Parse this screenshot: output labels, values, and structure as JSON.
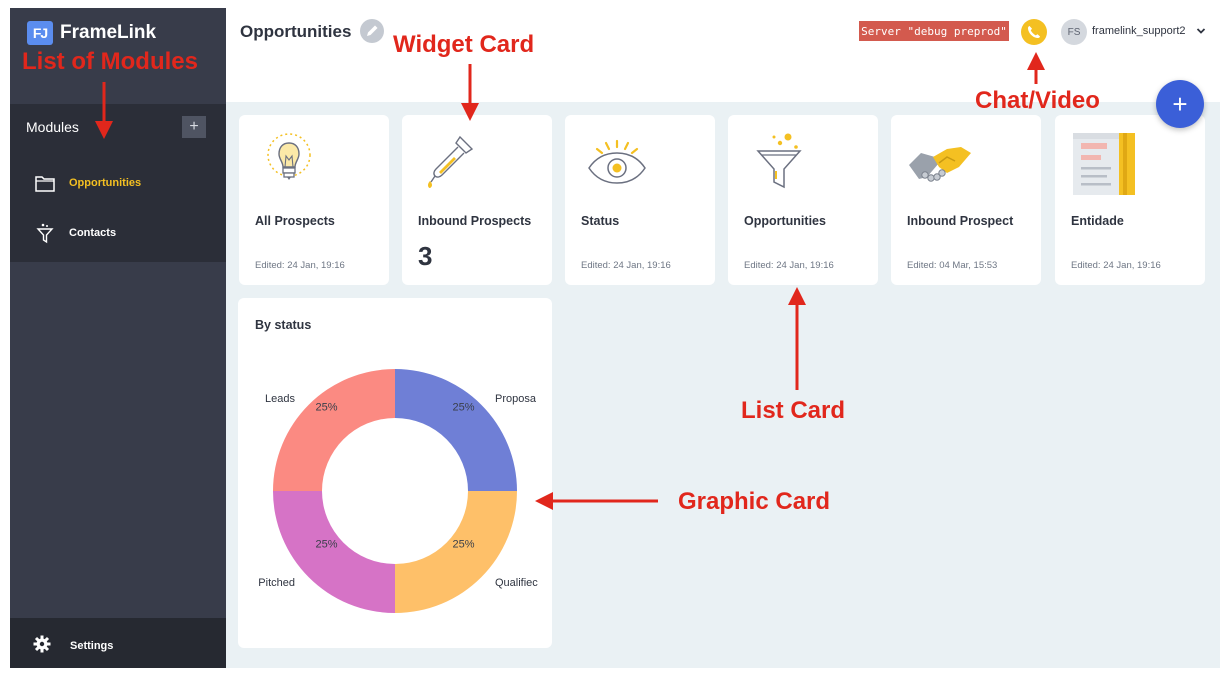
{
  "app": {
    "logo_mark": "FJ",
    "name": "FrameLink"
  },
  "sidebar": {
    "modules_header": "Modules",
    "add_label": "+",
    "items": [
      {
        "label": "Opportunities",
        "icon": "folder-icon",
        "active": true
      },
      {
        "label": "Contacts",
        "icon": "funnel-icon",
        "active": false
      }
    ],
    "settings_label": "Settings"
  },
  "header": {
    "title": "Opportunities",
    "server_badge": "Server \"debug preprod\"",
    "avatar_initials": "FS",
    "username": "framelink_support2"
  },
  "fab_label": "+",
  "cards": [
    {
      "name": "All Prospects",
      "edited": "Edited: 24 Jan, 19:16",
      "icon": "lightbulb-icon"
    },
    {
      "name": "Inbound Prospects",
      "count": "3",
      "icon": "dropper-icon"
    },
    {
      "name": "Status",
      "edited": "Edited: 24 Jan, 19:16",
      "icon": "eye-icon"
    },
    {
      "name": "Opportunities",
      "edited": "Edited: 24 Jan, 19:16",
      "icon": "funnel-icon"
    },
    {
      "name": "Inbound Prospect",
      "edited": "Edited: 04 Mar, 15:53",
      "icon": "handshake-icon"
    },
    {
      "name": "Entidade",
      "edited": "Edited: 24 Jan, 19:16",
      "icon": "document-icon"
    }
  ],
  "graph_card": {
    "title": "By status"
  },
  "chart_data": {
    "type": "pie",
    "title": "By status",
    "donut": true,
    "slices": [
      {
        "label": "Proposa",
        "value": 25,
        "display": "25%",
        "color": "#6f7fd6"
      },
      {
        "label": "Qualifiec",
        "value": 25,
        "display": "25%",
        "color": "#fec069"
      },
      {
        "label": "Pitched",
        "value": 25,
        "display": "25%",
        "color": "#d673c6"
      },
      {
        "label": "Leads",
        "value": 25,
        "display": "25%",
        "color": "#fb8a82"
      }
    ]
  },
  "annotations": {
    "list_of_modules": "List of Modules",
    "widget_card": "Widget Card",
    "chat_video": "Chat/Video",
    "list_card": "List Card",
    "graphic_card": "Graphic Card"
  },
  "colors": {
    "accent": "#f4c022",
    "annotation_red": "#e1271c",
    "fab_blue": "#3b5fd8",
    "sidebar": "#383c4a"
  }
}
